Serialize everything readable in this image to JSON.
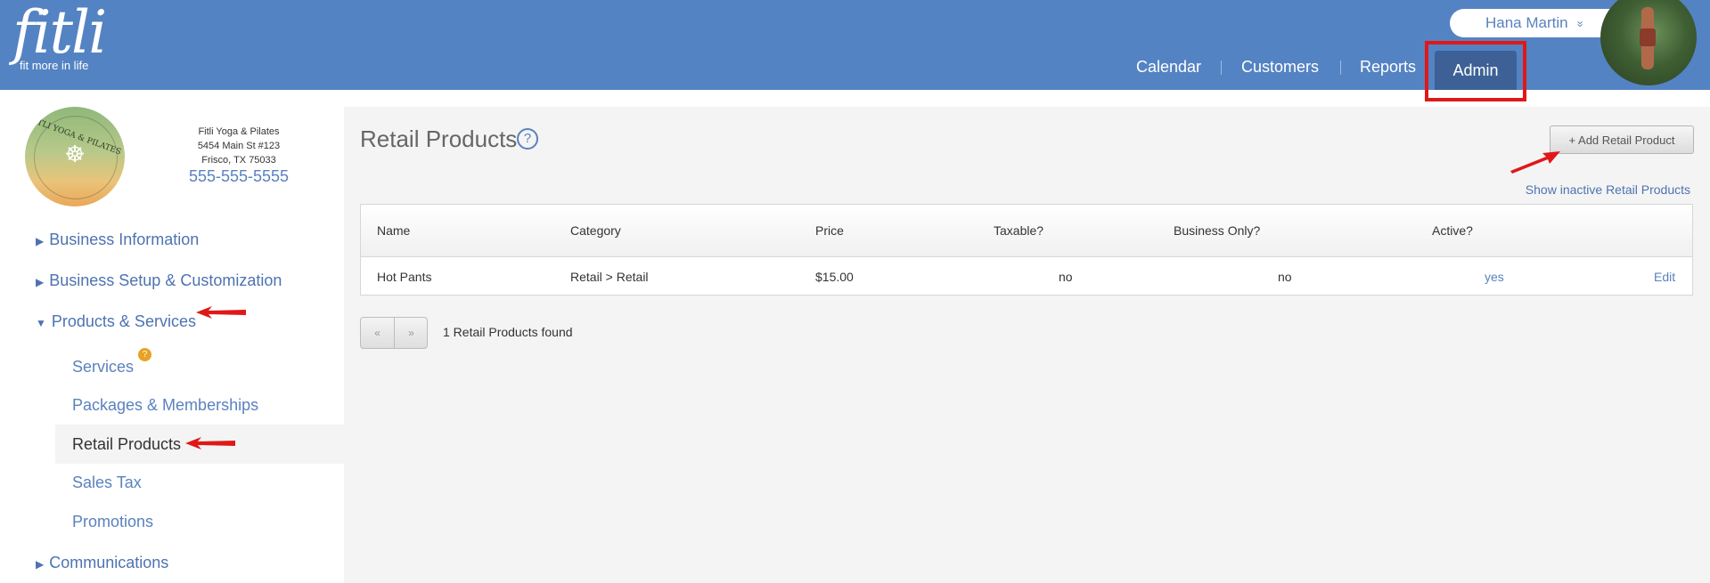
{
  "header": {
    "logo_word": "fitli",
    "logo_tag": "fit more in life",
    "user_name": "Hana Martin",
    "user_chevron": "»",
    "nav": [
      "Calendar",
      "Customers",
      "Reports"
    ],
    "admin_label": "Admin"
  },
  "business": {
    "logo_text": "FITLI YOGA & PILATES",
    "name": "Fitli Yoga & Pilates",
    "address1": "5454 Main St #123",
    "address2": "Frisco, TX 75033",
    "phone": "555-555-5555"
  },
  "sidebar": {
    "business_information": "Business Information",
    "business_setup": "Business Setup & Customization",
    "products_services": "Products & Services",
    "services": "Services",
    "services_badge": "?",
    "packages": "Packages & Memberships",
    "retail_products": "Retail Products",
    "sales_tax": "Sales Tax",
    "promotions": "Promotions",
    "communications": "Communications"
  },
  "main": {
    "title": "Retail Products",
    "help_glyph": "?",
    "add_button": "+ Add Retail Product",
    "show_inactive": "Show inactive Retail Products",
    "columns": [
      "Name",
      "Category",
      "Price",
      "Taxable?",
      "Business Only?",
      "Active?"
    ],
    "rows": [
      {
        "name": "Hot Pants",
        "category": "Retail > Retail",
        "price": "$15.00",
        "taxable": "no",
        "business_only": "no",
        "active": "yes",
        "edit": "Edit"
      }
    ],
    "pager_prev": "«",
    "pager_next": "»",
    "found_text": "1 Retail Products found"
  },
  "colors": {
    "header_bg": "#5483c3",
    "admin_tab": "#3d6196",
    "link": "#4d73b1",
    "highlight": "#e01818"
  }
}
